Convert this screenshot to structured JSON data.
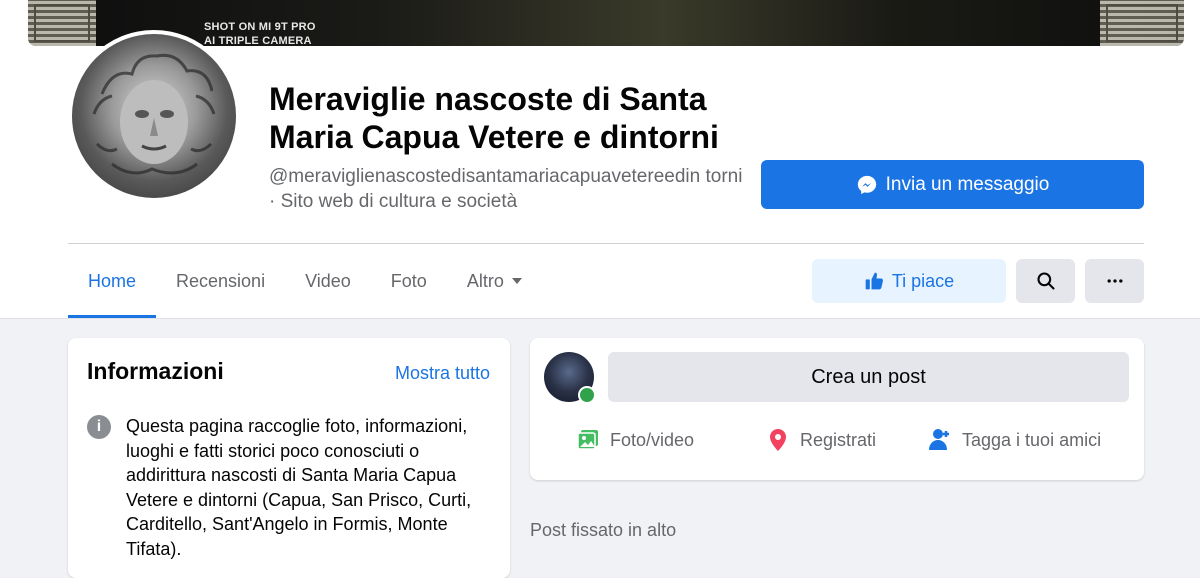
{
  "cover": {
    "watermark_line1": "SHOT ON MI 9T PRO",
    "watermark_line2": "AI TRIPLE CAMERA"
  },
  "page": {
    "title_line1": "Meraviglie nascoste di Santa",
    "title_line2": "Maria Capua Vetere e dintorni",
    "username": "@meraviglienascostedisantamariacapuavetereedin torni · Sito web di cultura e società"
  },
  "actions": {
    "message": "Invia un messaggio",
    "like": "Ti piace"
  },
  "tabs": [
    {
      "label": "Home",
      "active": true
    },
    {
      "label": "Recensioni"
    },
    {
      "label": "Video"
    },
    {
      "label": "Foto"
    },
    {
      "label": "Altro"
    }
  ],
  "info": {
    "title": "Informazioni",
    "show_all": "Mostra tutto",
    "description": "Questa pagina raccoglie foto, informazioni, luoghi e fatti storici poco conosciuti o addirittura nascosti di Santa Maria Capua Vetere e dintorni (Capua, San Prisco, Curti, Carditello, Sant'Angelo in Formis, Monte Tifata)."
  },
  "composer": {
    "create_post": "Crea un post",
    "photo_video": "Foto/video",
    "check_in": "Registrati",
    "tag_friends": "Tagga i tuoi amici"
  },
  "feed": {
    "pinned_label": "Post fissato in alto"
  },
  "colors": {
    "accent": "#1b74e4",
    "like_bg": "#e7f3ff",
    "online": "#31a24c",
    "photo_icon": "#45bd62",
    "checkin_icon": "#f3425f"
  },
  "icons": {
    "messenger": "messenger-icon",
    "like": "thumbs-up-icon",
    "search": "search-icon",
    "more": "more-icon",
    "info": "info-icon",
    "photo": "photo-icon",
    "checkin": "location-pin-icon",
    "tag": "tag-friends-icon",
    "dropdown": "caret-down-icon"
  }
}
